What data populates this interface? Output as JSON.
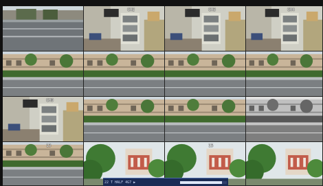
{
  "channels": [
    {
      "id": "ch1",
      "label": "",
      "scene": "street"
    },
    {
      "id": "ch2",
      "label": "CH2",
      "scene": "office"
    },
    {
      "id": "ch3",
      "label": "CH3",
      "scene": "office"
    },
    {
      "id": "ch4",
      "label": "CH4",
      "scene": "office"
    },
    {
      "id": "ch5",
      "label": "",
      "scene": "building"
    },
    {
      "id": "ch6",
      "label": "",
      "scene": "building"
    },
    {
      "id": "ch7",
      "label": "",
      "scene": "building"
    },
    {
      "id": "ch8",
      "label": "",
      "scene": "building"
    },
    {
      "id": "ch9",
      "label": "CH9",
      "scene": "office"
    },
    {
      "id": "ch10",
      "label": "",
      "scene": "building"
    },
    {
      "id": "ch11",
      "label": "",
      "scene": "building"
    },
    {
      "id": "ch12",
      "label": "",
      "scene": "building-gray"
    },
    {
      "id": "ch13",
      "label": "13",
      "scene": "building"
    },
    {
      "id": "ch14",
      "label": "",
      "scene": "trees"
    },
    {
      "id": "ch15",
      "label": "15",
      "scene": "trees"
    },
    {
      "id": "ch16",
      "label": "",
      "scene": "trees"
    }
  ],
  "status_bar": {
    "text": "22 T HALF 4G7 ▶",
    "progress": 0.9
  }
}
